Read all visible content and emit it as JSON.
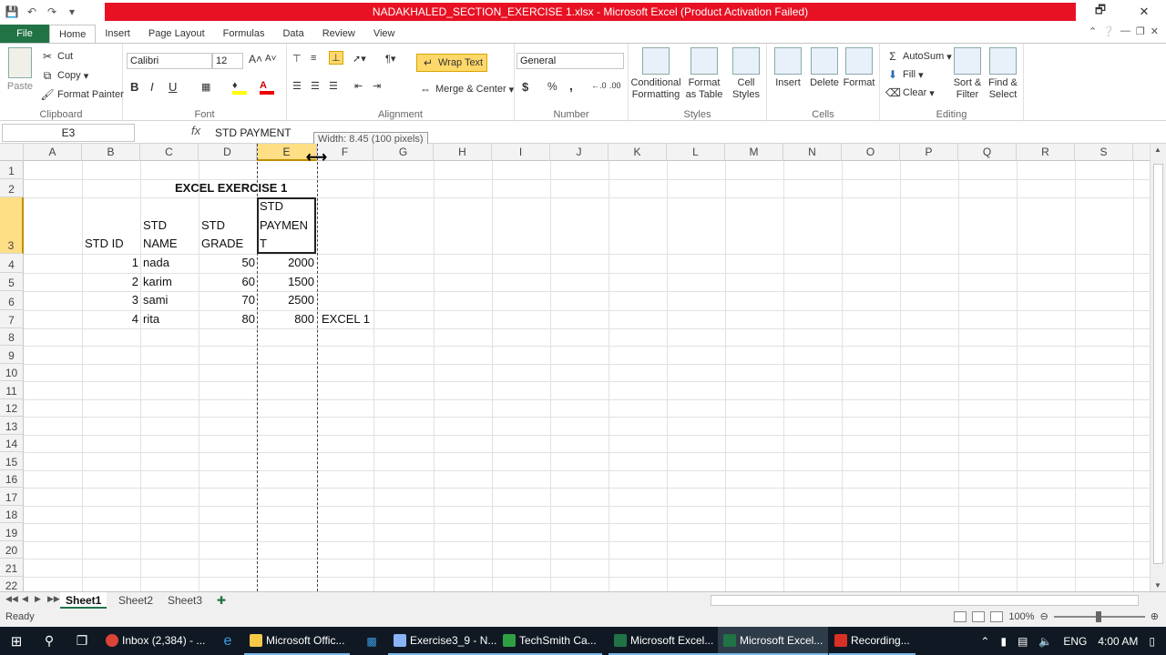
{
  "title_bar": {
    "title": "NADAKHALED_SECTION_EXERCISE 1.xlsx - Microsoft Excel (Product Activation Failed)",
    "qat": [
      "save-icon",
      "undo-icon",
      "redo-icon",
      "customize-icon"
    ]
  },
  "window_controls": {
    "restore": "🗗",
    "close": "✕"
  },
  "ribbon_tabs": [
    "File",
    "Home",
    "Insert",
    "Page Layout",
    "Formulas",
    "Data",
    "Review",
    "View"
  ],
  "ribbon": {
    "clipboard": {
      "paste": "Paste",
      "cut": "Cut",
      "copy": "Copy",
      "format_painter": "Format Painter",
      "label": "Clipboard"
    },
    "font": {
      "name": "Calibri",
      "size": "12",
      "bold": "B",
      "italic": "I",
      "underline": "U",
      "label": "Font"
    },
    "alignment": {
      "wrap_text": "Wrap Text",
      "merge_center": "Merge & Center",
      "label": "Alignment"
    },
    "number": {
      "format": "General",
      "currency": "$",
      "percent": "%",
      "comma": ",",
      "label": "Number"
    },
    "styles": {
      "conditional": "Conditional",
      "conditional2": "Formatting",
      "format_table": "Format",
      "format_table2": "as Table",
      "cell_styles": "Cell",
      "cell_styles2": "Styles",
      "label": "Styles"
    },
    "cells": {
      "insert": "Insert",
      "delete": "Delete",
      "format": "Format",
      "label": "Cells"
    },
    "editing": {
      "autosum": "AutoSum",
      "fill": "Fill",
      "clear": "Clear",
      "sort": "Sort &",
      "sort2": "Filter",
      "find": "Find &",
      "find2": "Select",
      "label": "Editing"
    }
  },
  "formula_bar": {
    "name_box": "E3",
    "fx": "fx",
    "value": "STD PAYMENT"
  },
  "tooltip": "Width: 8.45 (100 pixels)",
  "columns": [
    "A",
    "B",
    "C",
    "D",
    "E",
    "F",
    "G",
    "H",
    "I",
    "J",
    "K",
    "L",
    "M",
    "N",
    "O",
    "P",
    "Q",
    "R",
    "S"
  ],
  "rows": [
    "1",
    "2",
    "3",
    "4",
    "5",
    "6",
    "7",
    "8",
    "9",
    "10",
    "11",
    "12",
    "13",
    "14",
    "15",
    "16",
    "17",
    "18",
    "19",
    "20",
    "21",
    "22"
  ],
  "sheet": {
    "title": "EXCEL EXERCISE 1",
    "headers": {
      "b3": "STD ID",
      "c3a": "STD",
      "c3b": "NAME",
      "d3a": "STD",
      "d3b": "GRADE",
      "e3a": "STD",
      "e3b": "PAYMEN",
      "e3c": "T"
    },
    "data": [
      {
        "id": "1",
        "name": "nada",
        "grade": "50",
        "payment": "2000"
      },
      {
        "id": "2",
        "name": "karim",
        "grade": "60",
        "payment": "1500"
      },
      {
        "id": "3",
        "name": "sami",
        "grade": "70",
        "payment": "2500"
      },
      {
        "id": "4",
        "name": "rita",
        "grade": "80",
        "payment": "800"
      }
    ],
    "f7": "EXCEL 1"
  },
  "sheet_tabs": [
    "Sheet1",
    "Sheet2",
    "Sheet3"
  ],
  "status": {
    "ready": "Ready",
    "zoom": "100%"
  },
  "taskbar": {
    "apps": [
      "Inbox (2,384) - ...",
      "Microsoft Offic...",
      "Exercise3_9 - N...",
      "TechSmith Ca...",
      "Microsoft Excel...",
      "Microsoft Excel...",
      "Recording..."
    ],
    "lang": "ENG",
    "time": "4:00 AM"
  },
  "colors": {
    "excel_green": "#217346",
    "title_red": "#e81123",
    "selected_header": "#ffdf86"
  }
}
